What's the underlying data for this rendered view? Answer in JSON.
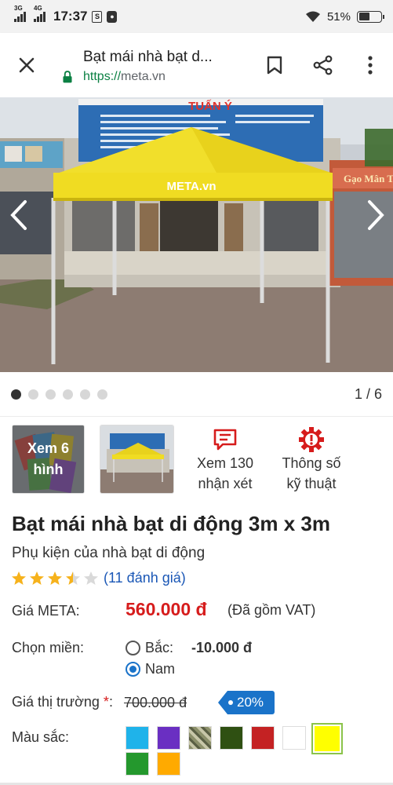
{
  "status_bar": {
    "network_1": "3G",
    "network_2": "4G",
    "time": "17:37",
    "battery_level": "51%",
    "battery_fraction": 0.51
  },
  "browser": {
    "page_title": "Bạt mái nhà bạt d...",
    "url_scheme": "https://",
    "url_host": "meta.vn"
  },
  "gallery": {
    "banner_name": "TUẤN Ý",
    "tent_brand": "META.vn",
    "counter": "1 / 6",
    "total_images": 6,
    "current_image": 1
  },
  "thumbs": {
    "more_images_label": "Xem 6 hình",
    "reviews_label": "Xem 130 nhận xét",
    "specs_label": "Thông số kỹ thuật"
  },
  "product": {
    "title": "Bạt mái nhà bạt di động 3m x 3m",
    "subtitle": "Phụ kiện của nhà bạt di động",
    "rating_value": 3.5,
    "rating_max": 5,
    "rating_link": "(11 đánh giá)",
    "price_label": "Giá META:",
    "price": "560.000 đ",
    "vat_note": "(Đã gồm VAT)",
    "region_label": "Chọn miền:",
    "regions": [
      {
        "label": "Bắc:",
        "diff": "-10.000 đ",
        "selected": false
      },
      {
        "label": "Nam",
        "selected": true
      }
    ],
    "market_label": "Giá thị trường",
    "market_required": "*",
    "market_colon": ":",
    "market_price": "700.000 đ",
    "discount": "20%",
    "colors_label": "Màu sắc:",
    "colors": [
      "#1fb3ea",
      "#6a2fc2",
      "camo",
      "#2f5012",
      "#c42223",
      "#ffffff",
      "#ffff00",
      "#24982d",
      "#ffaa00"
    ],
    "selected_color_index": 6
  },
  "colors": {
    "price_red": "#d61c1c",
    "link_blue": "#1a57b6",
    "accent_blue": "#1a73c9",
    "secure_green": "#0b8043",
    "star_gold": "#f6b21c"
  }
}
